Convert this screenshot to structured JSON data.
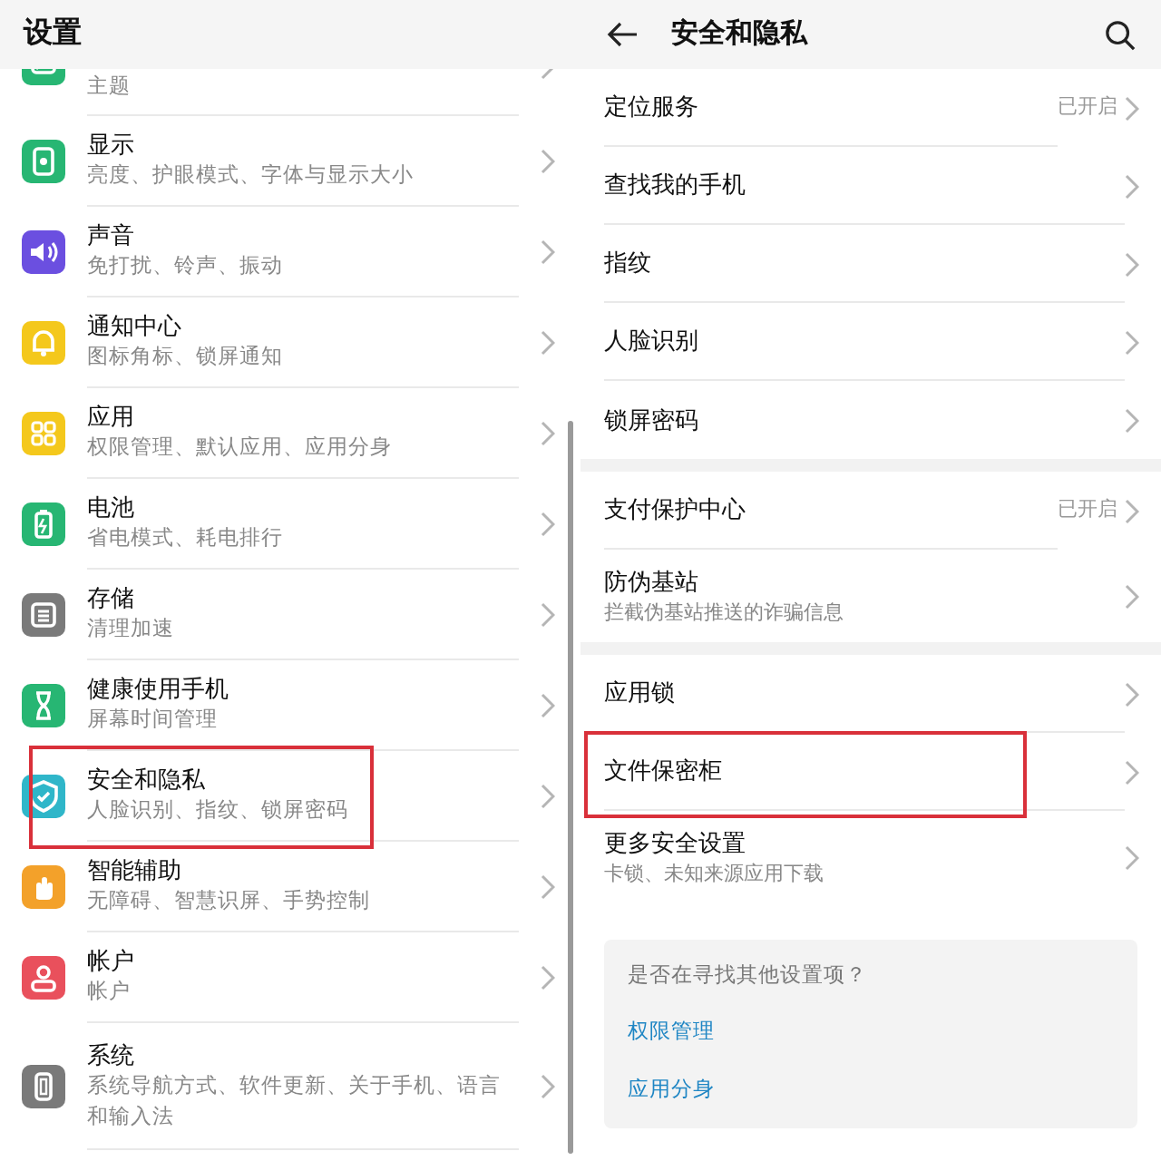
{
  "settings_screen": {
    "title": "设置",
    "items": [
      {
        "subtitle": "主题",
        "color": "#27b673",
        "highlighted": false
      },
      {
        "title": "显示",
        "subtitle": "亮度、护眼模式、字体与显示大小",
        "color": "#27b673",
        "highlighted": false
      },
      {
        "title": "声音",
        "subtitle": "免打扰、铃声、振动",
        "color": "#6b4fe0",
        "highlighted": false
      },
      {
        "title": "通知中心",
        "subtitle": "图标角标、锁屏通知",
        "color": "#f4c81c",
        "highlighted": false
      },
      {
        "title": "应用",
        "subtitle": "权限管理、默认应用、应用分身",
        "color": "#f4c81c",
        "highlighted": false
      },
      {
        "title": "电池",
        "subtitle": "省电模式、耗电排行",
        "color": "#27b673",
        "highlighted": false
      },
      {
        "title": "存储",
        "subtitle": "清理加速",
        "color": "#7a7a7a",
        "highlighted": false
      },
      {
        "title": "健康使用手机",
        "subtitle": "屏幕时间管理",
        "color": "#27b673",
        "highlighted": false
      },
      {
        "title": "安全和隐私",
        "subtitle": "人脸识别、指纹、锁屏密码",
        "color": "#2fb6c9",
        "highlighted": true
      },
      {
        "title": "智能辅助",
        "subtitle": "无障碍、智慧识屏、手势控制",
        "color": "#f3a12a",
        "highlighted": false
      },
      {
        "title": "帐户",
        "subtitle": "帐户",
        "color": "#e9505c",
        "highlighted": false
      },
      {
        "title": "系统",
        "subtitle": "系统导航方式、软件更新、关于手机、语言和输入法",
        "color": "#7a7a7a",
        "highlighted": false
      }
    ]
  },
  "security_screen": {
    "title": "安全和隐私",
    "groups": [
      [
        {
          "title": "定位服务",
          "status": "已开启",
          "highlighted": false
        },
        {
          "title": "查找我的手机",
          "highlighted": false
        },
        {
          "title": "指纹",
          "highlighted": false
        },
        {
          "title": "人脸识别",
          "highlighted": false
        },
        {
          "title": "锁屏密码",
          "highlighted": false
        }
      ],
      [
        {
          "title": "支付保护中心",
          "status": "已开启",
          "highlighted": false
        },
        {
          "title": "防伪基站",
          "subtitle": "拦截伪基站推送的诈骗信息",
          "highlighted": false
        }
      ],
      [
        {
          "title": "应用锁",
          "highlighted": false
        },
        {
          "title": "文件保密柜",
          "highlighted": true
        },
        {
          "title": "更多安全设置",
          "subtitle": "卡锁、未知来源应用下载",
          "highlighted": false
        }
      ]
    ],
    "suggestions": {
      "question": "是否在寻找其他设置项？",
      "links": [
        "权限管理",
        "应用分身"
      ]
    }
  }
}
